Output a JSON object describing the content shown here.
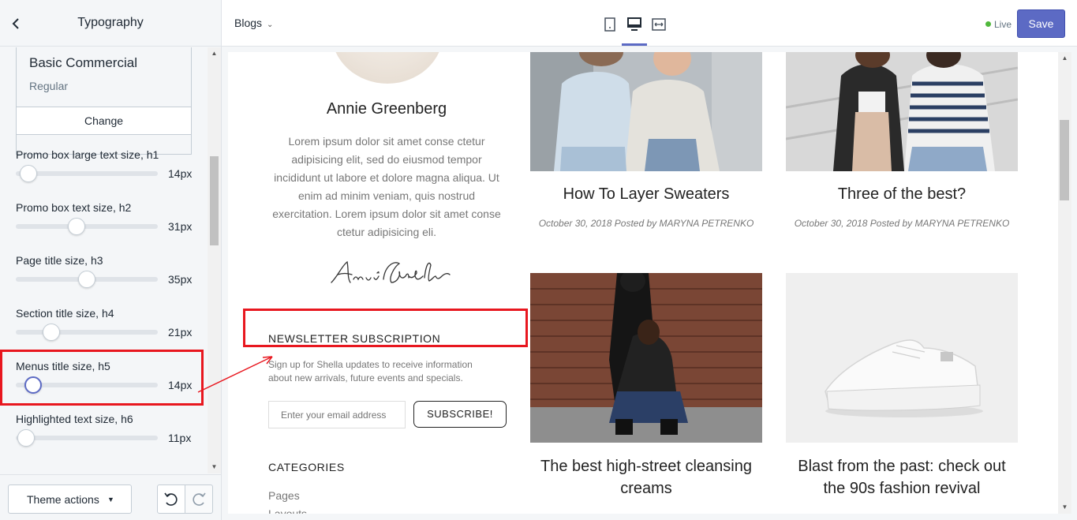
{
  "panel": {
    "title": "Typography",
    "font": {
      "name": "Basic Commercial",
      "style": "Regular",
      "change_label": "Change"
    },
    "settings": [
      {
        "label": "Promo box large text size, h1",
        "value": "14px",
        "level": 0.09
      },
      {
        "label": "Promo box text size, h2",
        "value": "31px",
        "level": 0.43
      },
      {
        "label": "Page title size, h3",
        "value": "35px",
        "level": 0.5
      },
      {
        "label": "Section title size, h4",
        "value": "21px",
        "level": 0.25
      },
      {
        "label": "Menus title size, h5",
        "value": "14px",
        "level": 0.12
      },
      {
        "label": "Highlighted text size, h6",
        "value": "11px",
        "level": 0.07
      }
    ],
    "footer": {
      "theme_actions_label": "Theme actions"
    }
  },
  "topbar": {
    "page_select_label": "Blogs",
    "devices": [
      "mobile-icon",
      "desktop-icon",
      "fullwidth-icon"
    ],
    "selected_device": "desktop",
    "status_label": "Live",
    "save_label": "Save",
    "accent_color": "#5c6ac4",
    "live_color": "#50b83c"
  },
  "preview": {
    "author": {
      "name": "Annie Greenberg",
      "bio": "Lorem ipsum dolor sit amet conse ctetur adipisicing elit, sed do eiusmod tempor incididunt ut labore et dolore magna aliqua. Ut enim ad minim veniam, quis nostrud exercitation. Lorem ipsum dolor sit amet conse ctetur adipisicing eli."
    },
    "newsletter": {
      "heading": "NEWSLETTER SUBSCRIPTION",
      "text": "Sign up for Shella updates to receive information about new arrivals, future events and specials.",
      "email_placeholder": "Enter your email address",
      "subscribe_label": "SUBSCRIBE!"
    },
    "categories": {
      "heading": "CATEGORIES",
      "items": [
        "Pages",
        "Layouts"
      ]
    },
    "posts": [
      {
        "title": "How To Layer Sweaters",
        "meta": "October 30, 2018 Posted by MARYNA PETRENKO"
      },
      {
        "title": "Three of the best?",
        "meta": "October 30, 2018 Posted by MARYNA PETRENKO"
      },
      {
        "title": "The best high-street cleansing creams",
        "meta": ""
      },
      {
        "title": "Blast from the past: check out the 90s fashion revival",
        "meta": ""
      }
    ]
  },
  "annotation_color": "#e8171f"
}
